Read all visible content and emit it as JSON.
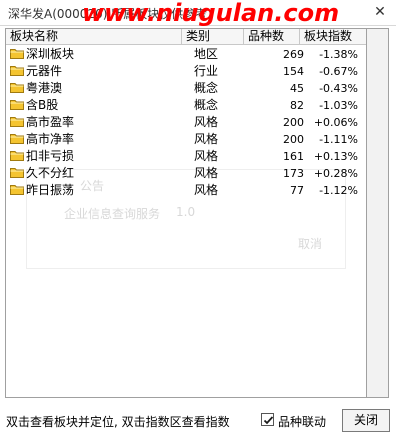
{
  "window": {
    "title": "深华发A(000020)  所属板块仅供参考",
    "watermark": "www.niugulan.com",
    "close_glyph": "✕"
  },
  "table": {
    "columns": [
      "板块名称",
      "类别",
      "品种数",
      "板块指数"
    ],
    "rows": [
      {
        "name": "深圳板块",
        "type": "地区",
        "count": "269",
        "index": "-1.38%",
        "icon": "folder-icon"
      },
      {
        "name": "元器件",
        "type": "行业",
        "count": "154",
        "index": "-0.67%",
        "icon": "folder-icon"
      },
      {
        "name": "粤港澳",
        "type": "概念",
        "count": "45",
        "index": "-0.43%",
        "icon": "folder-icon"
      },
      {
        "name": "含B股",
        "type": "概念",
        "count": "82",
        "index": "-1.03%",
        "icon": "folder-icon"
      },
      {
        "name": "高市盈率",
        "type": "风格",
        "count": "200",
        "index": "+0.06%",
        "icon": "folder-icon"
      },
      {
        "name": "高市净率",
        "type": "风格",
        "count": "200",
        "index": "-1.11%",
        "icon": "folder-icon"
      },
      {
        "name": "扣非亏损",
        "type": "风格",
        "count": "161",
        "index": "+0.13%",
        "icon": "folder-icon"
      },
      {
        "name": "久不分红",
        "type": "风格",
        "count": "173",
        "index": "+0.28%",
        "icon": "folder-icon"
      },
      {
        "name": "昨日振荡",
        "type": "风格",
        "count": "77",
        "index": "-1.12%",
        "icon": "folder-icon"
      }
    ]
  },
  "ghost": {
    "label1": "公告",
    "label2": "企业信息查询服务",
    "label3": "1.0",
    "button": "取消"
  },
  "footer": {
    "hint": "双击查看板块并定位, 双击指数区查看指数",
    "checkbox_label": "品种联动",
    "checkbox_checked": true,
    "close_label": "关闭"
  },
  "colors": {
    "watermark": "#ff0000",
    "folder": "#f4c430"
  }
}
